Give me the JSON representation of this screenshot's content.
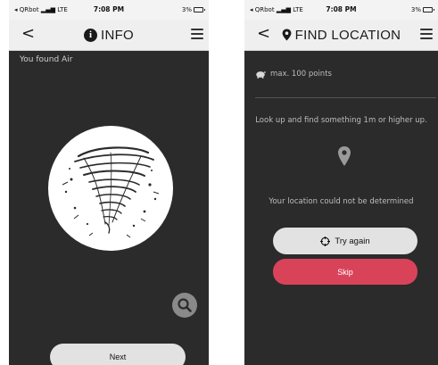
{
  "screen_info": {
    "status": {
      "carrier": "◂ QRbot",
      "network": "LTE",
      "time": "7:08 PM",
      "battery": "3%"
    },
    "nav": {
      "back": "<",
      "title": "INFO"
    },
    "found_text": "You found Air",
    "next_label": "Next"
  },
  "screen_location": {
    "status": {
      "carrier": "◂ QRbot",
      "network": "LTE",
      "time": "7:08 PM",
      "battery": "3%"
    },
    "nav": {
      "back": "<",
      "title": "FIND LOCATION"
    },
    "points_text": "max. 100 points",
    "hint_text": "Look up and find something 1m or higher up.",
    "location_message": "Your location could not be determined",
    "try_again_label": "Try again",
    "skip_label": "Skip"
  },
  "colors": {
    "screen_bg": "#2b2b2b",
    "header_bg": "#efefef",
    "skip_button": "#d9435a",
    "light_button": "#e2e2e2"
  }
}
